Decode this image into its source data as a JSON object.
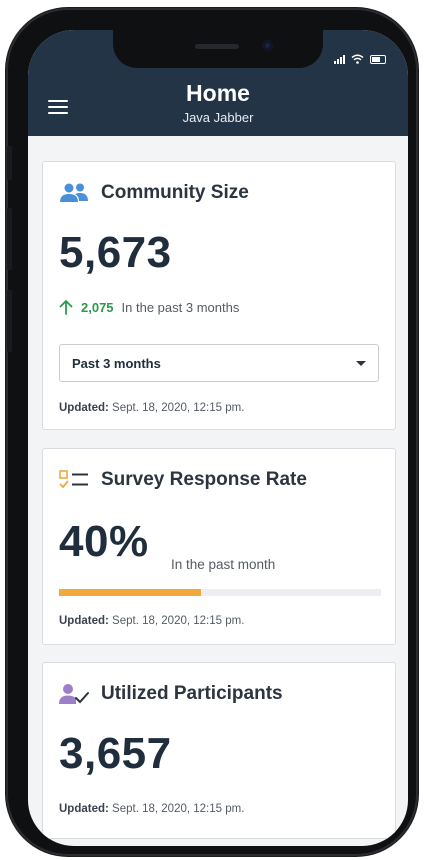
{
  "header": {
    "title": "Home",
    "subtitle": "Java Jabber"
  },
  "cards": {
    "community": {
      "title": "Community Size",
      "value": "5,673",
      "trend_value": "2,075",
      "trend_text": "In the past 3 months",
      "period_selected": "Past 3 months",
      "updated_label": "Updated:",
      "updated_time": "Sept. 18, 2020, 12:15 pm."
    },
    "survey": {
      "title": "Survey Response Rate",
      "value": "40%",
      "note": "In the past month",
      "progress_percent": 44,
      "updated_label": "Updated:",
      "updated_time": "Sept. 18, 2020, 12:15 pm."
    },
    "participants": {
      "title": "Utilized Participants",
      "value": "3,657",
      "updated_label": "Updated:",
      "updated_time": "Sept. 18, 2020, 12:15 pm."
    }
  },
  "icons": {
    "menu": "hamburger-menu-icon",
    "community": "people-icon",
    "survey": "checklist-icon",
    "participants": "user-check-icon",
    "trend": "arrow-up-icon",
    "dropdown": "caret-down-icon"
  },
  "colors": {
    "header_bg": "#243447",
    "accent_blue": "#4a90d9",
    "trend_green": "#2b9a4b",
    "progress_orange": "#f2a93b",
    "participant_purple": "#9b7fc9"
  }
}
